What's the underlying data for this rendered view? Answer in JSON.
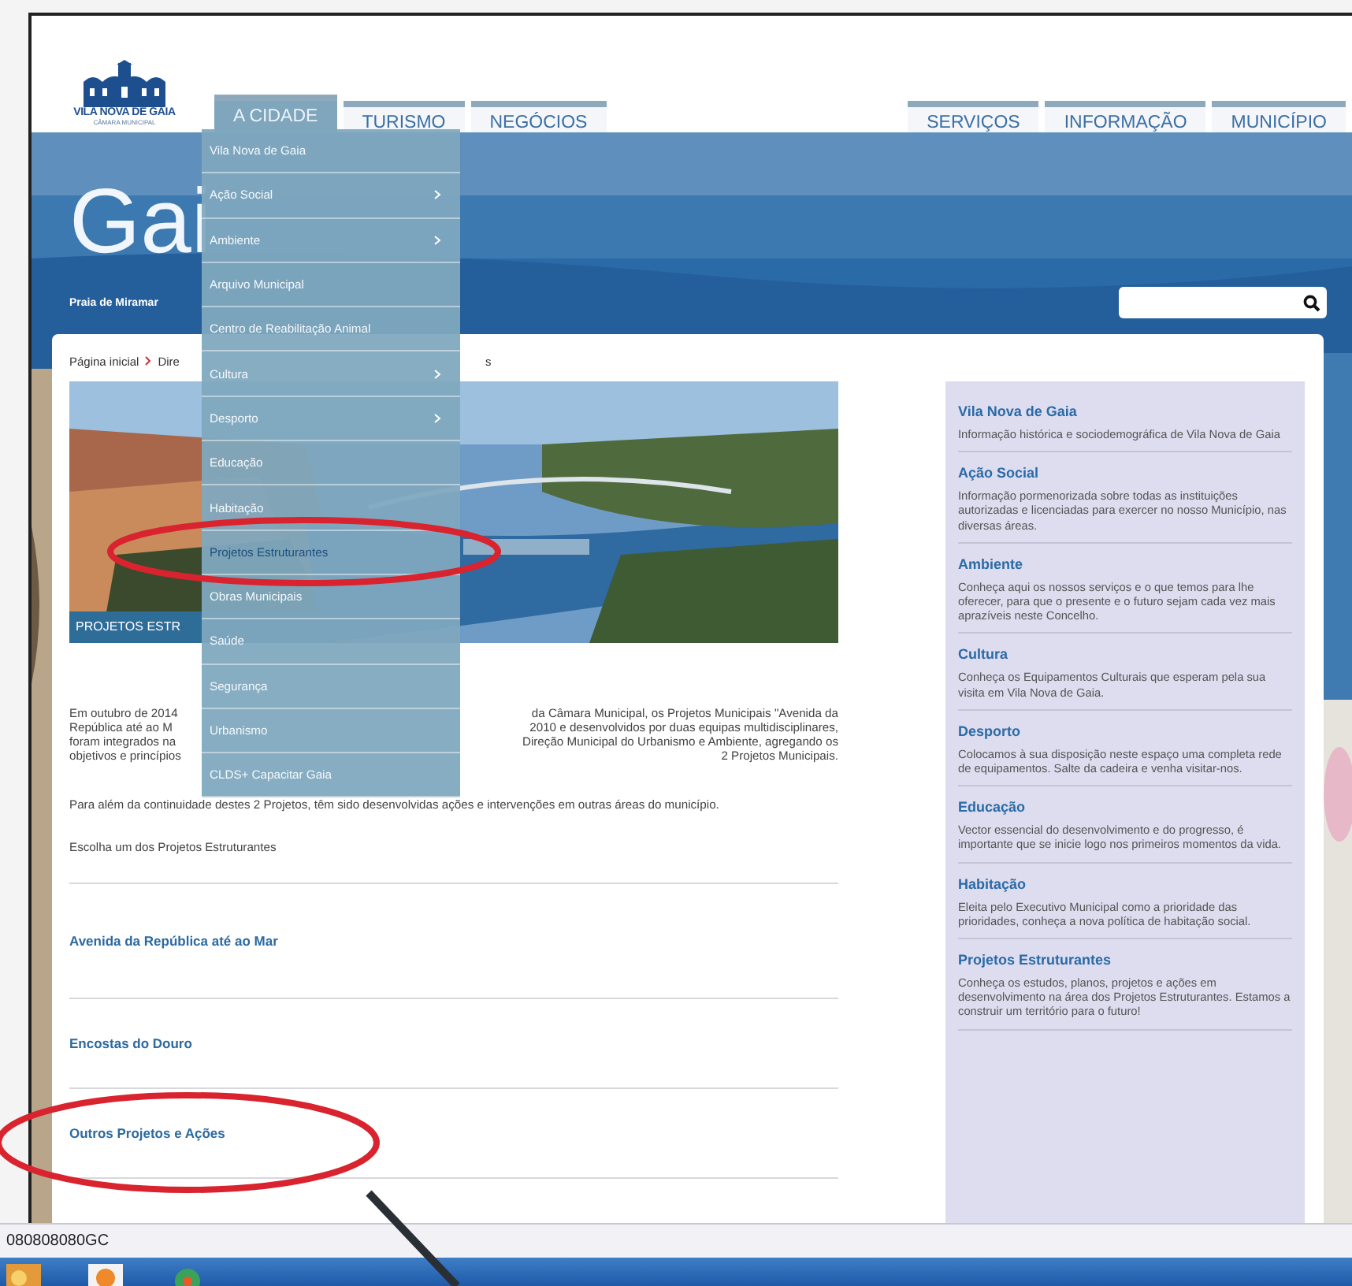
{
  "logo": {
    "name": "VILA NOVA DE GAIA",
    "subtitle": "CÂMARA MUNICIPAL"
  },
  "nav": [
    {
      "label": "A CIDADE",
      "selected": true
    },
    {
      "label": "TURISMO",
      "selected": false
    },
    {
      "label": "NEGÓCIOS",
      "selected": false
    },
    {
      "label": "SERVIÇOS",
      "selected": false
    },
    {
      "label": "INFORMAÇÃO",
      "selected": false
    },
    {
      "label": "MUNICÍPIO",
      "selected": false
    }
  ],
  "hero": {
    "title": "Gai",
    "caption": "Praia de Miramar"
  },
  "dropdown": [
    {
      "label": "Vila Nova de Gaia",
      "submenu": false,
      "selected": false
    },
    {
      "label": "Ação Social",
      "submenu": true,
      "selected": false
    },
    {
      "label": "Ambiente",
      "submenu": true,
      "selected": false
    },
    {
      "label": "Arquivo Municipal",
      "submenu": false,
      "selected": false
    },
    {
      "label": "Centro de Reabilitação Animal",
      "submenu": false,
      "selected": false
    },
    {
      "label": "Cultura",
      "submenu": true,
      "selected": false
    },
    {
      "label": "Desporto",
      "submenu": true,
      "selected": false
    },
    {
      "label": "Educação",
      "submenu": false,
      "selected": false
    },
    {
      "label": "Habitação",
      "submenu": false,
      "selected": false
    },
    {
      "label": "Projetos Estruturantes",
      "submenu": false,
      "selected": true
    },
    {
      "label": "Obras Municipais",
      "submenu": false,
      "selected": false
    },
    {
      "label": "Saúde",
      "submenu": false,
      "selected": false
    },
    {
      "label": "Segurança",
      "submenu": false,
      "selected": false
    },
    {
      "label": "Urbanismo",
      "submenu": false,
      "selected": false
    },
    {
      "label": "CLDS+ Capacitar Gaia",
      "submenu": false,
      "selected": false
    }
  ],
  "breadcrumb": {
    "items": [
      "Página inicial",
      "Dire"
    ],
    "tail": "s"
  },
  "photo_caption": "PROJETOS ESTR",
  "intro": {
    "left_lines": [
      "Em outubro de 2014",
      "República até ao M",
      "foram integrados na",
      "objetivos e princípios"
    ],
    "right_lines": [
      "da Câmara Municipal, os Projetos Municipais \"Avenida da",
      "2010 e desenvolvidos por duas equipas multidisciplinares,",
      "Direção Municipal do Urbanismo e Ambiente, agregando os",
      "2 Projetos Municipais."
    ]
  },
  "paragraph": "Para além da continuidade destes 2 Projetos, têm sido desenvolvidas ações e intervenções em outras áreas do município.",
  "prompt": "Escolha um dos Projetos Estruturantes",
  "links": [
    "Avenida da República até ao Mar",
    "Encostas do Douro",
    "Outros Projetos e Ações"
  ],
  "sidebar": [
    {
      "title": "Vila Nova de Gaia",
      "text": "Informação histórica e sociodemográfica de Vila Nova de Gaia"
    },
    {
      "title": "Ação Social",
      "text": "Informação pormenorizada sobre todas as instituições autorizadas e licenciadas para exercer no nosso Município, nas diversas áreas."
    },
    {
      "title": "Ambiente",
      "text": "Conheça aqui os nossos serviços e o que temos para lhe oferecer, para que o presente e o futuro sejam cada vez mais aprazíveis neste Concelho."
    },
    {
      "title": "Cultura",
      "text": "Conheça os Equipamentos Culturais que esperam pela sua visita em Vila Nova de Gaia."
    },
    {
      "title": "Desporto",
      "text": "Colocamos à sua disposição neste espaço uma completa rede de equipamentos. Salte da cadeira e venha visitar-nos."
    },
    {
      "title": "Educação",
      "text": "Vector essencial do desenvolvimento e do progresso, é importante que se inicie logo nos primeiros momentos da vida."
    },
    {
      "title": "Habitação",
      "text": "Eleita pelo Executivo Municipal como a prioridade das prioridades, conheça a nova política de habitação social."
    },
    {
      "title": "Projetos Estruturantes",
      "text": "Conheça os estudos, planos, projetos e ações em desenvolvimento na área dos Projetos Estruturantes. Estamos a construir um território para o futuro!"
    }
  ],
  "status_bar": "080808080GC"
}
